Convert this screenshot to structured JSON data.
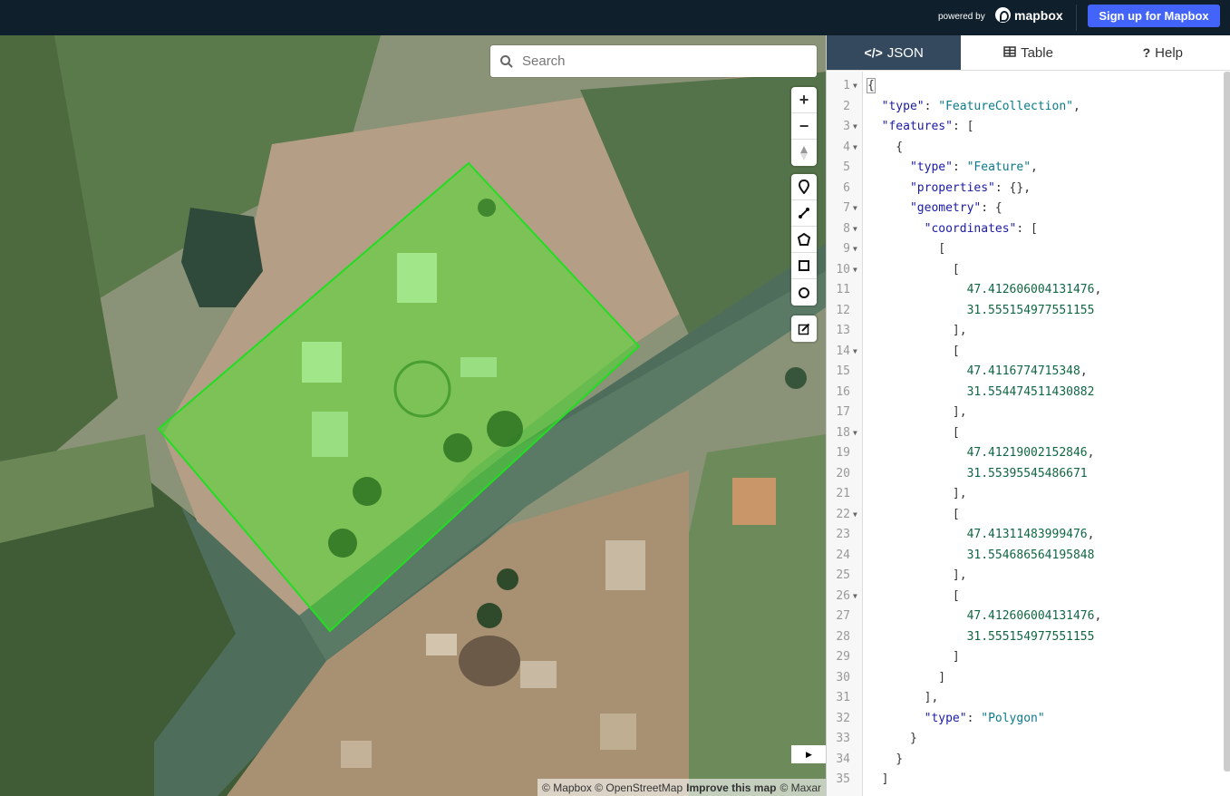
{
  "header": {
    "powered_by": "powered by",
    "brand": "mapbox",
    "signup_label": "Sign up for Mapbox"
  },
  "map": {
    "search_placeholder": "Search",
    "attribution": {
      "mapbox": "© Mapbox",
      "osm": "© OpenStreetMap",
      "improve": "Improve this map",
      "maxar": "© Maxar"
    },
    "controls": {
      "zoom_in": "+",
      "zoom_out": "−"
    }
  },
  "tabs": [
    {
      "label": "JSON",
      "icon": "code-icon"
    },
    {
      "label": "Table",
      "icon": "table-icon"
    },
    {
      "label": "Help",
      "icon": "help-icon"
    }
  ],
  "editor": {
    "lines": [
      "{",
      "  \"type\": \"FeatureCollection\",",
      "  \"features\": [",
      "    {",
      "      \"type\": \"Feature\",",
      "      \"properties\": {},",
      "      \"geometry\": {",
      "        \"coordinates\": [",
      "          [",
      "            [",
      "              47.412606004131476,",
      "              31.555154977551155",
      "            ],",
      "            [",
      "              47.4116774715348,",
      "              31.554474511430882",
      "            ],",
      "            [",
      "              47.41219002152846,",
      "              31.55395545486671",
      "            ],",
      "            [",
      "              47.41311483999476,",
      "              31.554686564195848",
      "            ],",
      "            [",
      "              47.412606004131476,",
      "              31.555154977551155",
      "            ]",
      "          ]",
      "        ],",
      "        \"type\": \"Polygon\"",
      "      }",
      "    }",
      "  ]"
    ],
    "folds": [
      1,
      3,
      4,
      7,
      8,
      9,
      10,
      14,
      18,
      22,
      26
    ]
  }
}
